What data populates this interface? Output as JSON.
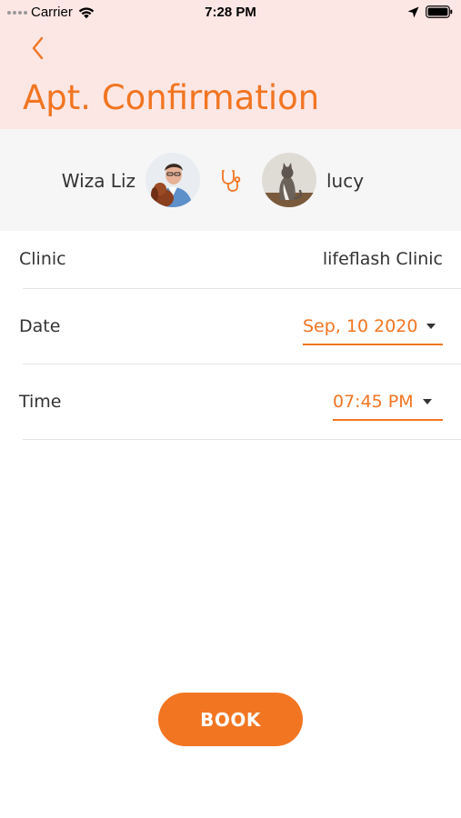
{
  "status_bar": {
    "carrier": "Carrier",
    "time": "7:28 PM",
    "icons": [
      "signal-dots-icon",
      "wifi-icon",
      "location-arrow-icon",
      "battery-icon"
    ]
  },
  "header": {
    "back_icon": "chevron-left-icon",
    "title": "Apt. Confirmation"
  },
  "participants": {
    "vet_name": "Wiza Liz",
    "connector_icon": "stethoscope-icon",
    "pet_name": "lucy"
  },
  "details": {
    "clinic_label": "Clinic",
    "clinic_value": "lifeflash Clinic",
    "date_label": "Date",
    "date_value": "Sep, 10 2020",
    "time_label": "Time",
    "time_value": "07:45 PM"
  },
  "actions": {
    "book_label": "BOOK"
  },
  "colors": {
    "accent": "#f27522",
    "header_bg": "#fde7e5",
    "participants_bg": "#f6f6f6"
  }
}
